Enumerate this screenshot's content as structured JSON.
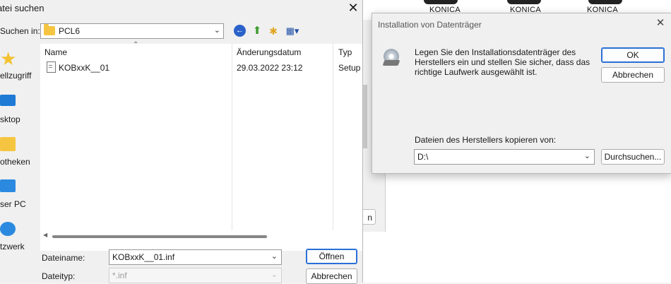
{
  "background": {
    "printer_labels": [
      "KONICA",
      "KONICA",
      "KONICA"
    ]
  },
  "file_dialog": {
    "title": "atei suchen",
    "close_glyph": "✕",
    "lookin_label": "Suchen in:",
    "lookin_value": "PCL6",
    "places": [
      "ellzugriff",
      "sktop",
      "otheken",
      "ser PC",
      "tzwerk"
    ],
    "columns": {
      "name": "Name",
      "date": "Änderungsdatum",
      "type": "Typ"
    },
    "files": [
      {
        "name": "KOBxxK__01",
        "date": "29.03.2022 23:12",
        "type": "Setup"
      }
    ],
    "filename_label": "Dateiname:",
    "filename_value": "KOBxxK__01.inf",
    "filetype_label": "Dateityp:",
    "filetype_value": "*.inf",
    "open_label": "Öffnen",
    "cancel_label": "Abbrechen"
  },
  "behind_dialog": {
    "button_fragment": "n"
  },
  "install_dialog": {
    "title": "Installation von Datenträger",
    "close_glyph": "✕",
    "message": "Legen Sie den Installationsdatenträger des Herstellers ein und stellen Sie sicher, dass das richtige Laufwerk ausgewählt ist.",
    "ok_label": "OK",
    "cancel_label": "Abbrechen",
    "copy_from_label": "Dateien des Herstellers kopieren von:",
    "path_value": "D:\\",
    "browse_label": "Durchsuchen..."
  },
  "colors": {
    "accent": "#2a6fd6",
    "folder": "#f5c542"
  }
}
